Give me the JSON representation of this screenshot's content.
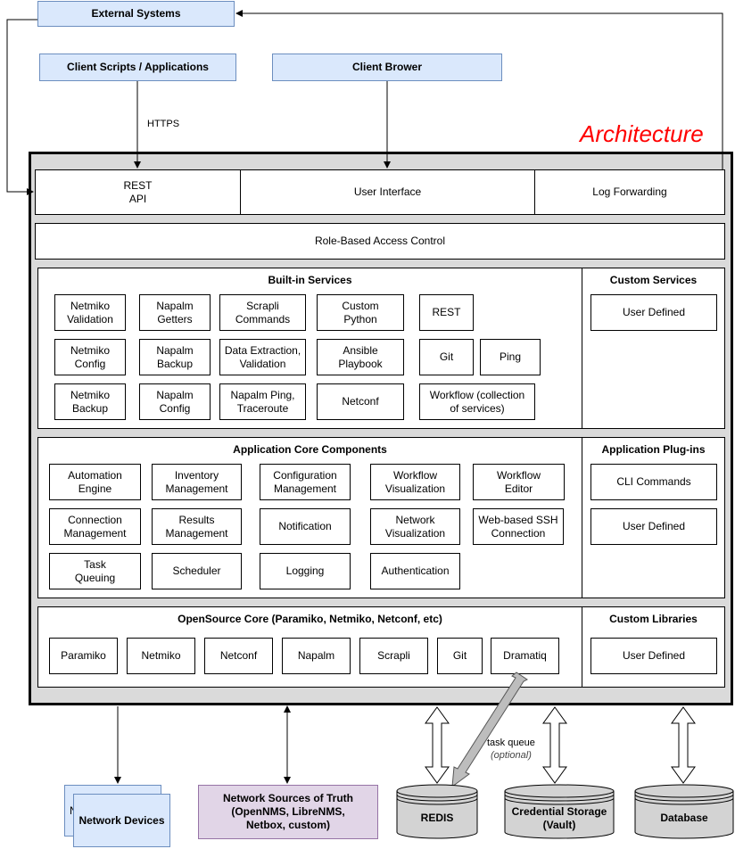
{
  "title": "Architecture",
  "external": {
    "external_systems": "External Systems",
    "client_scripts": "Client Scripts / Applications",
    "client_browser": "Client Brower",
    "https_label": "HTTPS"
  },
  "top_row": {
    "rest_api": "REST\nAPI",
    "user_interface": "User Interface",
    "log_forwarding": "Log Forwarding"
  },
  "rbac": "Role-Based Access Control",
  "builtin": {
    "title": "Built-in Services",
    "items": [
      "Netmiko\nValidation",
      "Napalm\nGetters",
      "Scrapli\nCommands",
      "Custom\nPython",
      "REST",
      "Netmiko\nConfig",
      "Napalm\nBackup",
      "Data Extraction,\nValidation",
      "Ansible\nPlaybook",
      "Git",
      "Ping",
      "Netmiko\nBackup",
      "Napalm\nConfig",
      "Napalm Ping,\nTraceroute",
      "Netconf",
      "Workflow (collection\nof services)"
    ]
  },
  "custom_services": {
    "title": "Custom Services",
    "items": [
      "User Defined"
    ]
  },
  "core": {
    "title": "Application Core Components",
    "items": [
      "Automation\nEngine",
      "Inventory\nManagement",
      "Configuration\nManagement",
      "Workflow\nVisualization",
      "Workflow\nEditor",
      "Connection\nManagement",
      "Results\nManagement",
      "Notification",
      "Network\nVisualization",
      "Web-based SSH\nConnection",
      "Task\nQueuing",
      "Scheduler",
      "Logging",
      "Authentication"
    ]
  },
  "plugins": {
    "title": "Application Plug-ins",
    "items": [
      "CLI Commands",
      "User Defined"
    ]
  },
  "opensource": {
    "title": "OpenSource Core (Paramiko, Netmiko, Netconf, etc)",
    "items": [
      "Paramiko",
      "Netmiko",
      "Netconf",
      "Napalm",
      "Scrapli",
      "Git",
      "Dramatiq"
    ]
  },
  "custom_libraries": {
    "title": "Custom Libraries",
    "items": [
      "User Defined"
    ]
  },
  "bottom": {
    "network_devices": "Network Devices",
    "network_devices_back": "N",
    "sources_of_truth": "Network Sources of Truth\n(OpenNMS, LibreNMS,\nNetbox, custom)",
    "redis": "REDIS",
    "credential_storage": "Credential Storage\n(Vault)",
    "database": "Database",
    "task_queue": "task queue",
    "optional": "(optional)"
  },
  "colors": {
    "blue_fill": "#dae8fc",
    "blue_border": "#6c8ebf",
    "purple_fill": "#e1d5e7",
    "purple_border": "#9673a6",
    "frame_fill": "#dadada",
    "title": "#ff0000",
    "cylinder": "#d3d3d3"
  }
}
